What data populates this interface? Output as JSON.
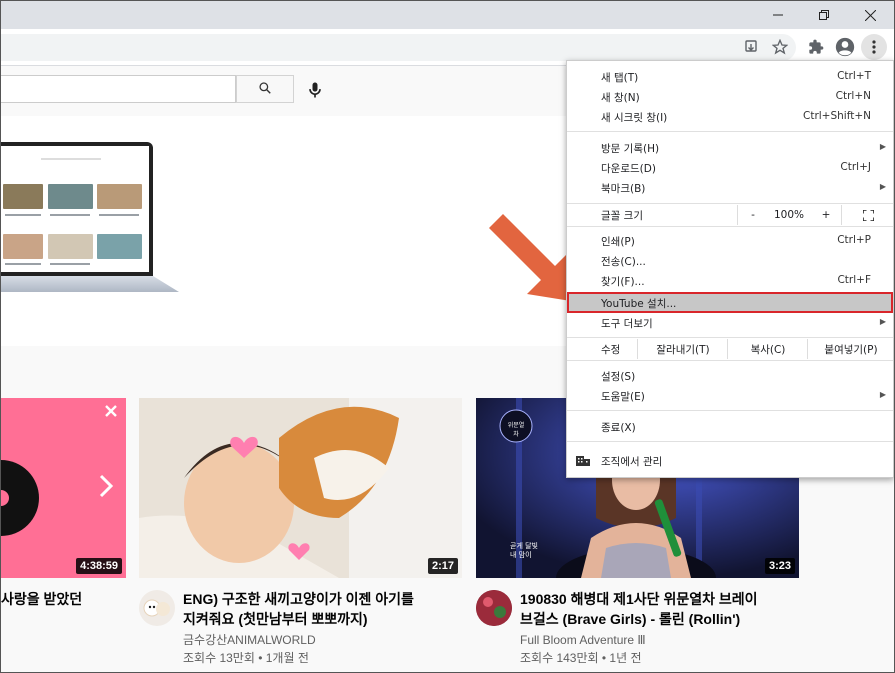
{
  "window": {
    "minimize_icon": "minimize-icon",
    "maximize_icon": "restore-icon",
    "close_icon": "close-icon"
  },
  "toolbar": {
    "icons": [
      "install-app-icon",
      "bookmark-star-icon",
      "extensions-puzzle-icon",
      "profile-avatar-icon",
      "chrome-menu-kebab-icon"
    ]
  },
  "youtube": {
    "search_icon": "search-icon",
    "mic_icon": "microphone-icon"
  },
  "videos": [
    {
      "title": "사랑을 받았던",
      "duration": "4:38:59",
      "thumb_color": "#ff6b91"
    },
    {
      "title_line1": "ENG) 구조한 새끼고양이가 이젠 아기를",
      "title_line2": "지켜줘요 (첫만남부터 뽀뽀까지)",
      "channel": "금수강산ANIMALWORLD",
      "meta": "조회수 13만회 • 1개월 전",
      "duration": "2:17"
    },
    {
      "title_line1": "190830 해병대 제1사단 위문열차 브레이",
      "title_line2": "브걸스 (Brave Girls) - 롤린 (Rollin')",
      "channel": "Full Bloom Adventure Ⅲ",
      "meta": "조회수 143만회 • 1년 전",
      "duration": "3:23",
      "thumb_caption_top": "위문열차",
      "thumb_caption": "곧게 달빛\n내 맘이"
    }
  ],
  "menu": {
    "new_tab": {
      "label": "새 탭(T)",
      "shortcut": "Ctrl+T"
    },
    "new_window": {
      "label": "새 창(N)",
      "shortcut": "Ctrl+N"
    },
    "new_incognito": {
      "label": "새 시크릿 창(I)",
      "shortcut": "Ctrl+Shift+N"
    },
    "history": {
      "label": "방문 기록(H)"
    },
    "downloads": {
      "label": "다운로드(D)",
      "shortcut": "Ctrl+J"
    },
    "bookmarks": {
      "label": "북마크(B)"
    },
    "zoom": {
      "label": "글꼴 크기",
      "minus": "-",
      "value": "100%",
      "plus": "+",
      "fullscreen_icon": "fullscreen-icon"
    },
    "print": {
      "label": "인쇄(P)",
      "shortcut": "Ctrl+P"
    },
    "cast": {
      "label": "전송(C)..."
    },
    "find": {
      "label": "찾기(F)...",
      "shortcut": "Ctrl+F"
    },
    "install": {
      "label": "YouTube 설치..."
    },
    "more_tools": {
      "label": "도구 더보기"
    },
    "edit": {
      "label": "수정",
      "cut": "잘라내기(T)",
      "copy": "복사(C)",
      "paste": "붙여넣기(P)"
    },
    "settings": {
      "label": "설정(S)"
    },
    "help": {
      "label": "도움말(E)"
    },
    "exit": {
      "label": "종료(X)"
    },
    "managed": {
      "label": "조직에서 관리",
      "icon": "building-icon"
    }
  },
  "annotation": {
    "arrow_color": "#e2653f",
    "highlight_color": "#d9262b"
  }
}
